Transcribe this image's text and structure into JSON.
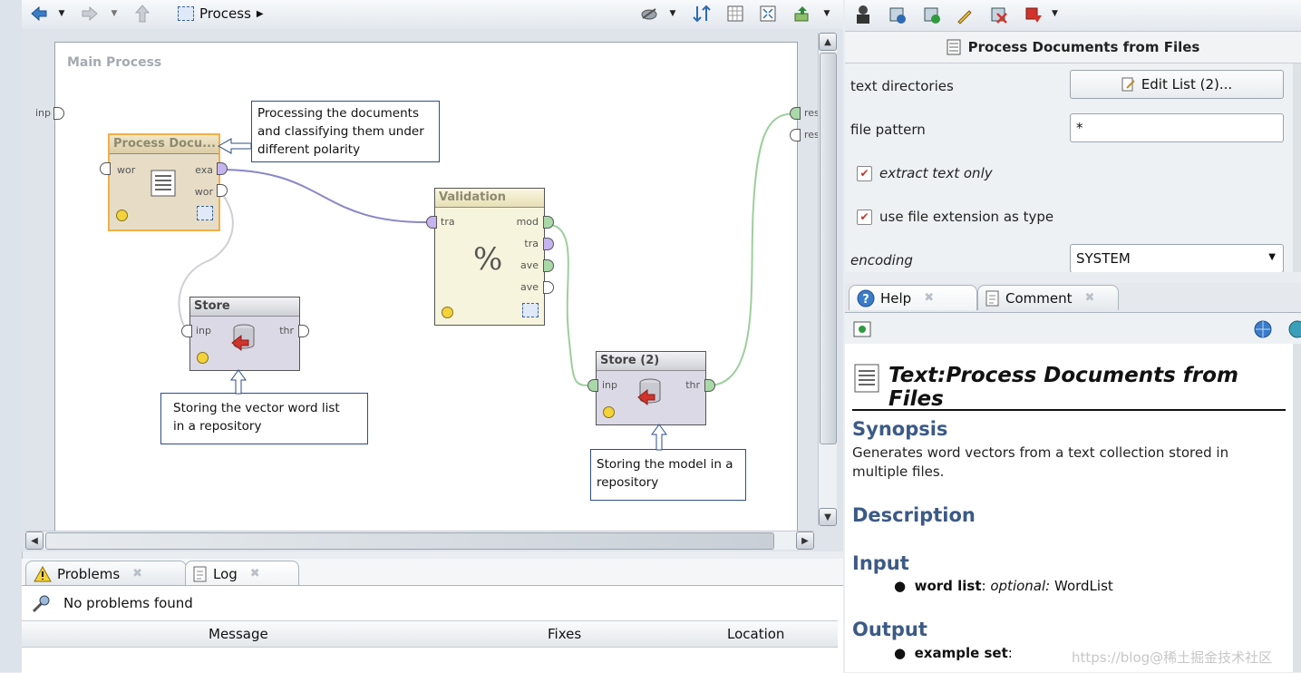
{
  "toolbar": {
    "breadcrumb": "Process"
  },
  "canvas": {
    "title": "Main Process",
    "left_port": "inp",
    "right_ports": [
      "res",
      "res"
    ],
    "operators": {
      "process_docs": {
        "title": "Process Docu...",
        "in_ports": [
          "wor"
        ],
        "out_ports": [
          "exa",
          "wor"
        ]
      },
      "validation": {
        "title": "Validation",
        "in_ports": [
          "tra"
        ],
        "out_ports": [
          "mod",
          "tra",
          "ave",
          "ave"
        ],
        "glyph": "%"
      },
      "store1": {
        "title": "Store",
        "in_ports": [
          "inp"
        ],
        "out_ports": [
          "thr"
        ]
      },
      "store2": {
        "title": "Store (2)",
        "in_ports": [
          "inp"
        ],
        "out_ports": [
          "thr"
        ]
      }
    },
    "notes": {
      "processing": [
        "Processing the documents",
        "and classifying them under",
        "different polarity"
      ],
      "storing_vector": [
        "Storing the vector word list",
        "in a repository"
      ],
      "storing_model": [
        "Storing the model in a",
        "repository"
      ]
    }
  },
  "problems": {
    "tabs": [
      {
        "label": "Problems"
      },
      {
        "label": "Log"
      }
    ],
    "status": "No problems found",
    "columns": [
      "Message",
      "Fixes",
      "Location"
    ]
  },
  "parameters": {
    "title": "Process Documents from Files",
    "rows": {
      "text_directories": {
        "label": "text directories",
        "button": "Edit List (2)..."
      },
      "file_pattern": {
        "label": "file pattern",
        "value": "*"
      },
      "extract_text_only": {
        "label": "extract text only",
        "checked": true
      },
      "use_file_ext": {
        "label": "use file extension as type",
        "checked": true
      },
      "encoding": {
        "label": "encoding",
        "value": "SYSTEM"
      }
    }
  },
  "help": {
    "tabs": [
      {
        "label": "Help"
      },
      {
        "label": "Comment"
      }
    ],
    "title": "Text:Process Documents from Files",
    "synopsis_heading": "Synopsis",
    "synopsis": "Generates word vectors from a text collection stored in multiple files.",
    "description_heading": "Description",
    "input_heading": "Input",
    "input_item": {
      "name": "word list",
      "optional": "optional:",
      "type": "WordList"
    },
    "output_heading": "Output",
    "output_item": {
      "name": "example set"
    }
  },
  "watermark": "https://blog@稀土掘金技术社区"
}
